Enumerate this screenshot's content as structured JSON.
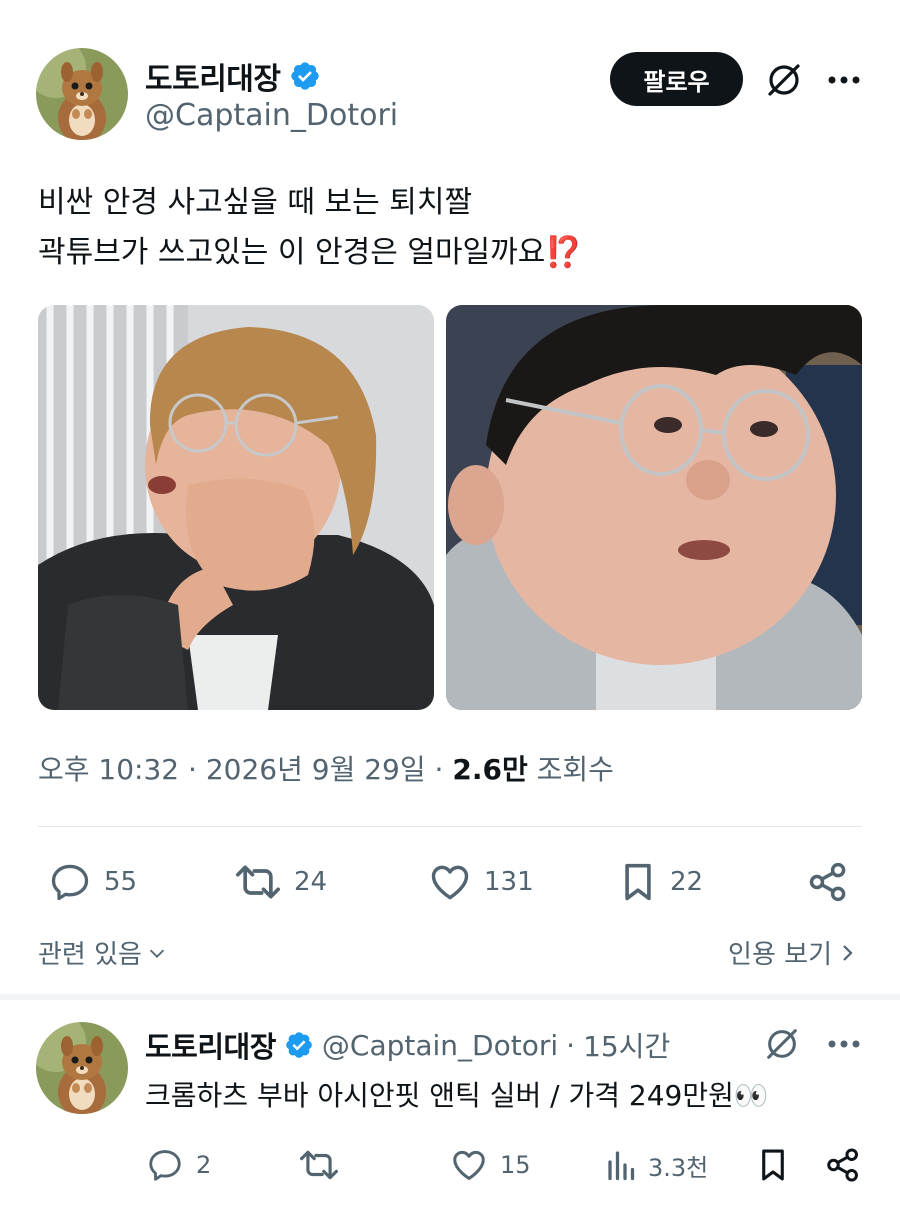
{
  "main_tweet": {
    "author": {
      "display_name": "도토리대장",
      "handle": "@Captain_Dotori"
    },
    "follow_label": "팔로우",
    "text_lines": [
      "비싼 안경 사고싶을 때 보는 퇴치짤",
      "곽튜브가 쓰고있는 이 안경은 얼마일까요⁉️"
    ],
    "time": "오후 10:32",
    "date": "2026년 9월 29일",
    "views_count": "2.6만",
    "views_label": "조회수",
    "stats": {
      "replies": "55",
      "retweets": "24",
      "likes": "131",
      "bookmarks": "22"
    },
    "related_label": "관련 있음",
    "quote_label": "인용 보기"
  },
  "reply_tweet": {
    "author": {
      "display_name": "도토리대장",
      "handle": "@Captain_Dotori"
    },
    "time_ago": "15시간",
    "text": "크롬하츠 부바 아시안핏 앤틱 실버 / 가격 249만원👀",
    "stats": {
      "replies": "2",
      "retweets": "",
      "likes": "15",
      "views": "3.3천"
    }
  },
  "colors": {
    "text_primary": "#0f1419",
    "text_secondary": "#536471",
    "verified": "#1d9bf0",
    "follow_button": "#0f1419"
  },
  "icons": [
    "verified-badge-icon",
    "grok-icon",
    "more-icon",
    "reply-icon",
    "retweet-icon",
    "like-icon",
    "bookmark-icon",
    "share-icon",
    "views-icon",
    "chevron-down-icon",
    "chevron-right-icon"
  ]
}
